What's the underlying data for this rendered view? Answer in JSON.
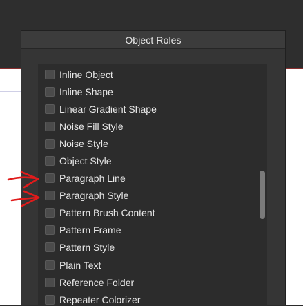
{
  "colors": {
    "accent_line": "#8a2f2f",
    "annotation_ink": "#e01b1b",
    "panel_bg": "#353535",
    "list_bg": "#2c2c2c",
    "text": "#e8e8e8"
  },
  "panel": {
    "title": "Object Roles"
  },
  "list": {
    "items": [
      {
        "label": "Inline Object",
        "checked": false
      },
      {
        "label": "Inline Shape",
        "checked": false
      },
      {
        "label": "Linear Gradient Shape",
        "checked": false
      },
      {
        "label": "Noise Fill Style",
        "checked": false
      },
      {
        "label": "Noise Style",
        "checked": false
      },
      {
        "label": "Object Style",
        "checked": false
      },
      {
        "label": "Paragraph Line",
        "checked": false
      },
      {
        "label": "Paragraph Style",
        "checked": false
      },
      {
        "label": "Pattern Brush Content",
        "checked": false
      },
      {
        "label": "Pattern Frame",
        "checked": false
      },
      {
        "label": "Pattern Style",
        "checked": false
      },
      {
        "label": "Plain Text",
        "checked": false
      },
      {
        "label": "Reference Folder",
        "checked": false
      },
      {
        "label": "Repeater Colorizer",
        "checked": false
      }
    ],
    "scroll_position": 0.55,
    "visible_fraction": 0.2
  },
  "annotation": {
    "marks": [
      "red arrow pointing at Paragraph Line",
      "red arrow pointing at Paragraph Style"
    ]
  }
}
